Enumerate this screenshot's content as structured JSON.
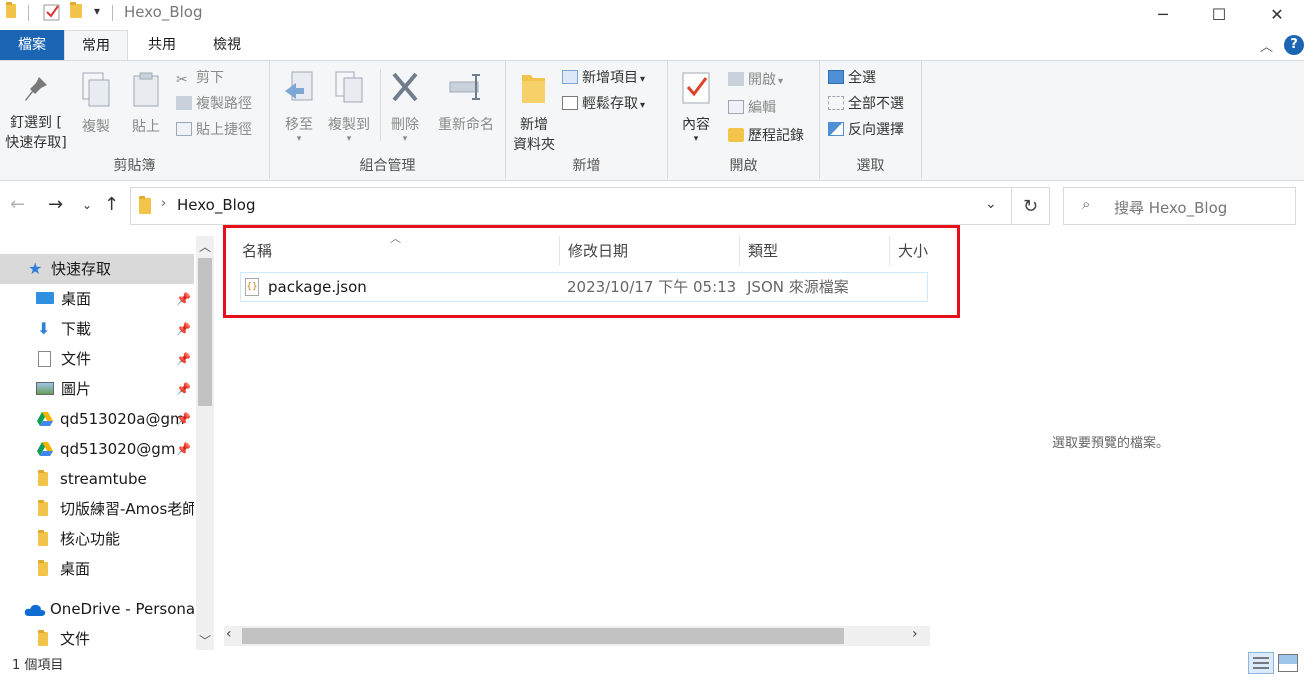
{
  "window": {
    "title": "Hexo_Blog",
    "minimize_icon": "─",
    "maximize_icon": "☐",
    "close_icon": "✕"
  },
  "tabs": [
    {
      "label": "檔案"
    },
    {
      "label": "常用"
    },
    {
      "label": "共用"
    },
    {
      "label": "檢視"
    }
  ],
  "ribbon": {
    "clipboard": {
      "label": "剪貼簿",
      "pin_quick_access": [
        "釘選到 [",
        "快速存取]"
      ],
      "copy": "複製",
      "paste": "貼上",
      "cut": "剪下",
      "copy_path": "複製路徑",
      "paste_shortcut": "貼上捷徑"
    },
    "organize": {
      "label": "組合管理",
      "move_to": "移至",
      "copy_to": "複製到",
      "delete": "刪除",
      "rename": "重新命名"
    },
    "new": {
      "label": "新增",
      "new_folder": [
        "新增",
        "資料夾"
      ],
      "new_item": "新增項目",
      "easy_access": "輕鬆存取"
    },
    "open": {
      "label": "開啟",
      "properties": "內容",
      "open": "開啟",
      "edit": "編輯",
      "history": "歷程記錄"
    },
    "select": {
      "label": "選取",
      "select_all": "全選",
      "select_none": "全部不選",
      "invert": "反向選擇"
    }
  },
  "address": {
    "path": "Hexo_Blog",
    "search_placeholder": "搜尋 Hexo_Blog"
  },
  "nav": {
    "items": [
      {
        "label": "快速存取",
        "icon": "star-icon"
      },
      {
        "label": "桌面",
        "icon": "desktop-icon"
      },
      {
        "label": "下載",
        "icon": "download-icon"
      },
      {
        "label": "文件",
        "icon": "document-icon"
      },
      {
        "label": "圖片",
        "icon": "picture-icon"
      },
      {
        "label": "qd513020a@gm",
        "icon": "google-drive-icon"
      },
      {
        "label": "qd513020@gm",
        "icon": "google-drive-icon"
      },
      {
        "label": "streamtube",
        "icon": "folder-icon"
      },
      {
        "label": "切版練習-Amos老師",
        "icon": "folder-icon"
      },
      {
        "label": "核心功能",
        "icon": "folder-icon"
      },
      {
        "label": "桌面",
        "icon": "folder-icon"
      },
      {
        "label": "OneDrive - Personal",
        "icon": "onedrive-icon"
      },
      {
        "label": "文件",
        "icon": "folder-icon"
      }
    ]
  },
  "columns": {
    "name": "名稱",
    "modified": "修改日期",
    "type": "類型",
    "size": "大小"
  },
  "files": [
    {
      "name": "package.json",
      "modified": "2023/10/17 下午 05:13",
      "type": "JSON 來源檔案"
    }
  ],
  "preview": {
    "message": "選取要預覽的檔案。"
  },
  "status": {
    "count": "1 個項目"
  },
  "colors": {
    "file_tab": "#1b65b4",
    "highlight": "#e5101b",
    "folder": "#f3c44a"
  }
}
